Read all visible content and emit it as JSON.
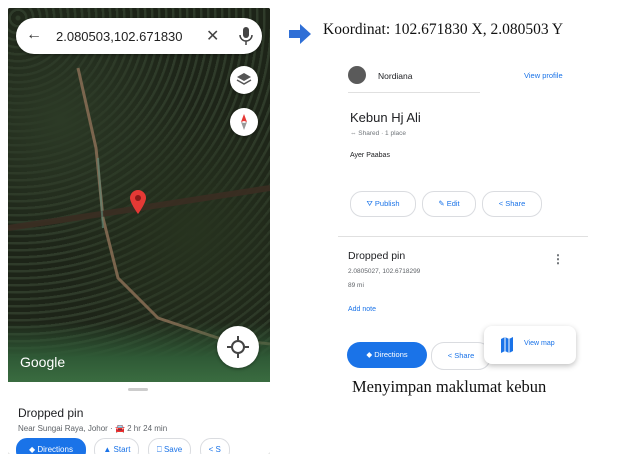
{
  "phone": {
    "search_text": "2.080503,102.671830",
    "map_attribution": "Google",
    "sheet": {
      "title": "Dropped pin",
      "subtitle": "Near Sungai Raya, Johor · 🚘 2 hr 24 min",
      "actions": [
        "Directions",
        "Start",
        "Save",
        "S"
      ]
    }
  },
  "coordinate_label": "Koordinat: 102.671830 X, 2.080503 Y",
  "panel": {
    "user_name": "Nordiana",
    "view_profile": "View profile",
    "list_title": "Kebun Hj Ali",
    "list_meta": "⇔ Shared · 1 place",
    "list_place": "Ayer Paabas",
    "list_actions": [
      "Publish",
      "Edit",
      "Share"
    ],
    "pin_title": "Dropped pin",
    "pin_coords": "2.0805027, 102.6718299",
    "pin_distance": "89 mi",
    "add_note": "Add note",
    "directions": "Directions",
    "share": "Share",
    "view_map": "View map"
  },
  "caption": "Menyimpan maklumat kebun",
  "colors": {
    "accent": "#1a73e8",
    "pin": "#e53935",
    "arrow": "#2f6fd6"
  }
}
